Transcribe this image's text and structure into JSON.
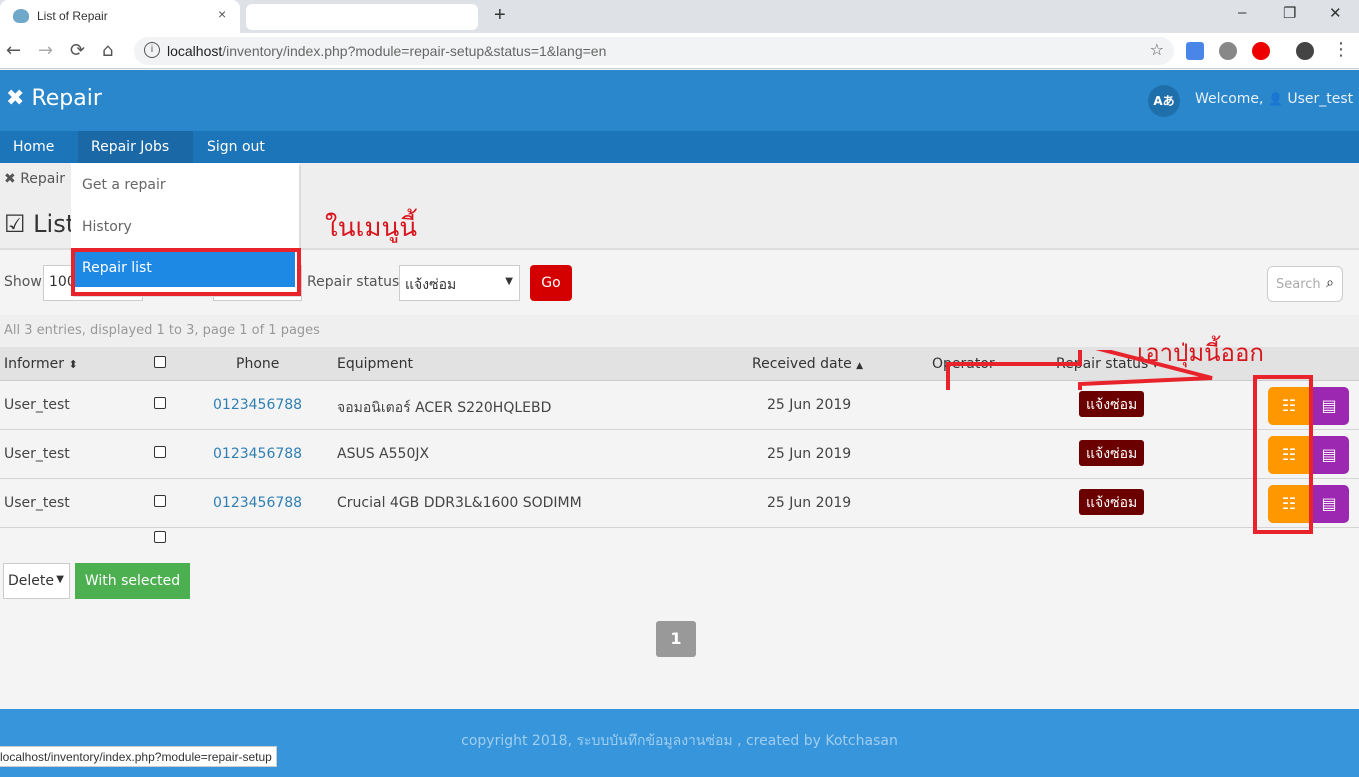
{
  "browser": {
    "tab_title": "List of Repair",
    "tab_close": "×",
    "new_tab": "+",
    "url_host": "localhost",
    "url_path": "/inventory/index.php?module=repair-setup&status=1&lang=en",
    "status_url": "localhost/inventory/index.php?module=repair-setup",
    "window_min": "–",
    "window_max": "❐",
    "window_close": "✕",
    "icons": {
      "back": "←",
      "forward": "→",
      "reload": "⟳",
      "home": "⌂",
      "star": "☆",
      "menu": "⋮",
      "info": "i"
    }
  },
  "header": {
    "app_title": "Repair",
    "logo_icon": "✖",
    "lang_button": "Aあ",
    "welcome": "Welcome,",
    "user_icon": "👤",
    "username": "User_test"
  },
  "menu": {
    "items": [
      {
        "label": "Home"
      },
      {
        "label": "Repair Jobs ▾"
      },
      {
        "label": "Sign out"
      }
    ],
    "dropdown": [
      "Get a repair",
      "History",
      "Repair list"
    ]
  },
  "breadcrumb": {
    "icon": "✖",
    "label": "Repair"
  },
  "page": {
    "title": "List",
    "title_icon": "☑"
  },
  "filters": {
    "show_label": "Show",
    "show_value": "100",
    "status_label": "Repair status",
    "status_value": "แจ้งซ่อม",
    "go_label": "Go",
    "search_placeholder": "Search",
    "search_icon": "🔍"
  },
  "summary": "All 3 entries, displayed 1 to 3, page 1 of 1 pages",
  "table": {
    "headers": {
      "informer": "Informer",
      "phone": "Phone",
      "equipment": "Equipment",
      "received": "Received date",
      "operator": "Operator",
      "status": "Repair status"
    },
    "sort_icons": {
      "informer": "⬍",
      "received": "▲",
      "status": "▾"
    },
    "rows": [
      {
        "informer": "User_test",
        "phone": "0123456788",
        "equipment": "จอมอนิเตอร์ ACER S220HQLEBD",
        "received": "25 Jun 2019",
        "operator": "",
        "status": "แจ้งซ่อม"
      },
      {
        "informer": "User_test",
        "phone": "0123456788",
        "equipment": "ASUS A550JX",
        "received": "25 Jun 2019",
        "operator": "",
        "status": "แจ้งซ่อม"
      },
      {
        "informer": "User_test",
        "phone": "0123456788",
        "equipment": "Crucial 4GB DDR3L&1600 SODIMM",
        "received": "25 Jun 2019",
        "operator": "",
        "status": "แจ้งซ่อม"
      }
    ],
    "row_action_icons": {
      "status": "☷",
      "detail": "▤"
    }
  },
  "bulk": {
    "action_value": "Delete",
    "apply_label": "With selected"
  },
  "pagination": {
    "current": "1"
  },
  "footer": "copyright 2018, ระบบบันทึกข้อมูลงานซ่อม , created by Kotchasan",
  "annotations": {
    "menu_note": "ในเมนูนี้",
    "button_note": "เอาปุ่มนี้ออก",
    "color": "#e8232b"
  },
  "colors": {
    "header": "#2a87cc",
    "menubar": "#1d75b9",
    "go": "#d40000",
    "status_badge": "#6b0000",
    "status_btn": "#ff9800",
    "detail_btn": "#9c27b0",
    "with_selected": "#4caf50",
    "footer": "#3796db"
  }
}
